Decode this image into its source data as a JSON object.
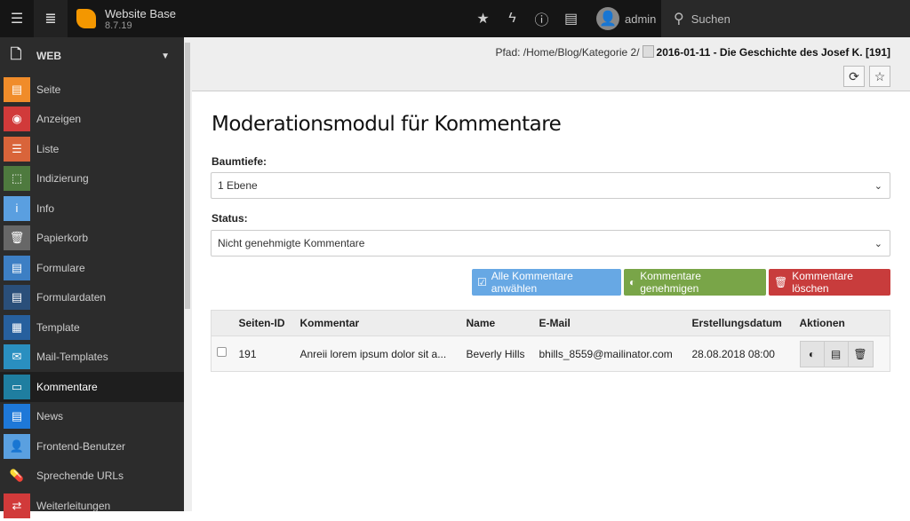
{
  "topbar": {
    "site_name": "Website Base",
    "version": "8.7.19",
    "user": "admin",
    "search_label": "Suchen"
  },
  "sidebar": {
    "group": "WEB",
    "items": [
      {
        "label": "Seite",
        "color": "#f08c2a",
        "icon": "▤"
      },
      {
        "label": "Anzeigen",
        "color": "#d13a3a",
        "icon": "◉"
      },
      {
        "label": "Liste",
        "color": "#d9643a",
        "icon": "☰"
      },
      {
        "label": "Indizierung",
        "color": "#4e7a3e",
        "icon": "⬚"
      },
      {
        "label": "Info",
        "color": "#5a9fe0",
        "icon": "i"
      },
      {
        "label": "Papierkorb",
        "color": "#676767",
        "icon": "🗑"
      },
      {
        "label": "Formulare",
        "color": "#3d7fc4",
        "icon": "▤"
      },
      {
        "label": "Formulardaten",
        "color": "#2a4f7a",
        "icon": "▤"
      },
      {
        "label": "Template",
        "color": "#27609e",
        "icon": "▦"
      },
      {
        "label": "Mail-Templates",
        "color": "#2a8fc0",
        "icon": "✉"
      },
      {
        "label": "Kommentare",
        "color": "#1f7ea0",
        "icon": "▭"
      },
      {
        "label": "News",
        "color": "#1e78d8",
        "icon": "▤"
      },
      {
        "label": "Frontend-Benutzer",
        "color": "#5aa0e0",
        "icon": "👤"
      },
      {
        "label": "Sprechende URLs",
        "color": "#2c2c2c",
        "icon": "💊"
      },
      {
        "label": "Weiterleitungen",
        "color": "#d13a3a",
        "icon": "⇄"
      }
    ],
    "active": "Kommentare"
  },
  "docheader": {
    "path_prefix": "Pfad: /Home/Blog/Kategorie 2/",
    "page_title": "2016-01-11 - Die Geschichte des Josef K. [191]"
  },
  "main": {
    "title": "Moderationsmodul für Kommentare",
    "depth_label": "Baumtiefe:",
    "depth_value": "1 Ebene",
    "status_label": "Status:",
    "status_value": "Nicht genehmigte Kommentare",
    "buttons": {
      "select_all": "Alle Kommentare anwählen",
      "approve": "Kommentare genehmigen",
      "delete": "Kommentare löschen"
    },
    "colors": {
      "select_all": "#67a8e4",
      "approve": "#79a548",
      "delete": "#c83c3c"
    },
    "table": {
      "headers": [
        "Seiten-ID",
        "Kommentar",
        "Name",
        "E-Mail",
        "Erstellungsdatum",
        "Aktionen"
      ],
      "rows": [
        {
          "page_id": "191",
          "comment": "Anreii lorem ipsum dolor sit a...",
          "name": "Beverly Hills",
          "email": "bhills_8559@mailinator.com",
          "date": "28.08.2018 08:00"
        }
      ]
    }
  }
}
